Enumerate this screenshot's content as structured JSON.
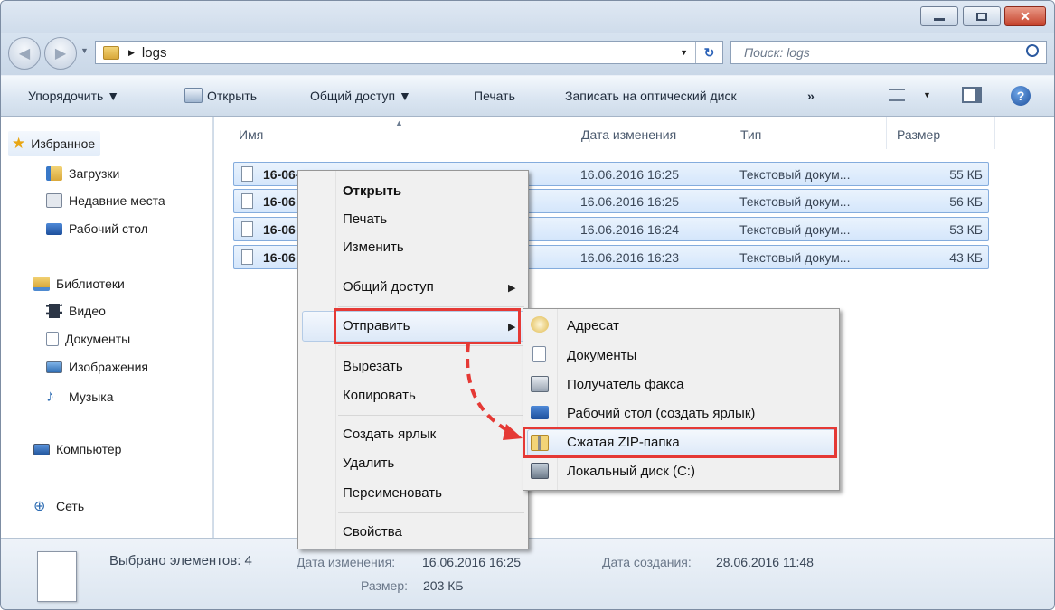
{
  "address": {
    "folder": "logs",
    "search_placeholder": "Поиск: logs"
  },
  "toolbar": {
    "organize": "Упорядочить ▼",
    "open": "Открыть",
    "share": "Общий доступ ▼",
    "print": "Печать",
    "burn": "Записать на оптический диск",
    "more": "»"
  },
  "nav": {
    "favorites": "Избранное",
    "downloads": "Загрузки",
    "recent": "Недавние места",
    "desktop": "Рабочий стол",
    "libraries": "Библиотеки",
    "video": "Видео",
    "documents": "Документы",
    "pictures": "Изображения",
    "music": "Музыка",
    "computer": "Компьютер",
    "network": "Сеть"
  },
  "columns": {
    "name": "Имя",
    "date": "Дата изменения",
    "type": "Тип",
    "size": "Размер"
  },
  "files": [
    {
      "name": "16-06-2016_lc_120674",
      "date": "16.06.2016 16:25",
      "type": "Текстовый докум...",
      "size": "55 КБ"
    },
    {
      "name": "16-06",
      "date": "16.06.2016 16:25",
      "type": "Текстовый докум...",
      "size": "56 КБ"
    },
    {
      "name": "16-06",
      "date": "16.06.2016 16:24",
      "type": "Текстовый докум...",
      "size": "53 КБ"
    },
    {
      "name": "16-06",
      "date": "16.06.2016 16:23",
      "type": "Текстовый докум...",
      "size": "43 КБ"
    }
  ],
  "context_menu": {
    "open": "Открыть",
    "print": "Печать",
    "edit": "Изменить",
    "share": "Общий доступ",
    "send_to": "Отправить",
    "cut": "Вырезать",
    "copy": "Копировать",
    "shortcut": "Создать ярлык",
    "delete": "Удалить",
    "rename": "Переименовать",
    "properties": "Свойства"
  },
  "send_to_menu": {
    "mail": "Адресат",
    "documents": "Документы",
    "fax": "Получатель факса",
    "desktop": "Рабочий стол (создать ярлык)",
    "zip": "Сжатая ZIP-папка",
    "local_disk": "Локальный диск (C:)"
  },
  "status": {
    "selected": "Выбрано элементов: 4",
    "modified_label": "Дата изменения:",
    "modified_value": "16.06.2016 16:25",
    "created_label": "Дата создания:",
    "created_value": "28.06.2016 11:48",
    "size_label": "Размер:",
    "size_value": "203 КБ"
  },
  "colors": {
    "highlight": "#e53935",
    "selection": "#d4e6fb"
  }
}
